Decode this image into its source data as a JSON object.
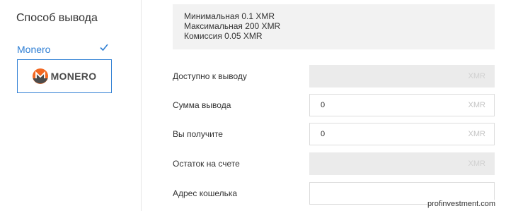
{
  "sidebar": {
    "title": "Способ вывода",
    "method_name": "Monero",
    "card_brand": "MONERO"
  },
  "info": {
    "lines": [
      "Минимальная 0.1 XMR",
      "Максимальная 200 XMR",
      "Комиссия 0.05 XMR"
    ]
  },
  "form": {
    "available": {
      "label": "Доступно к выводу",
      "value": "",
      "unit": "XMR"
    },
    "amount": {
      "label": "Сумма вывода",
      "value": "0",
      "unit": "XMR"
    },
    "receive": {
      "label": "Вы получите",
      "value": "0",
      "unit": "XMR"
    },
    "balance": {
      "label": "Остаток на счете",
      "value": "",
      "unit": "XMR"
    },
    "wallet": {
      "label": "Адрес кошелька",
      "value": ""
    }
  },
  "watermark": "profinvestment.com",
  "colors": {
    "accent": "#2f7fd4",
    "monero_orange": "#f26822",
    "monero_gray": "#4c4c4c"
  }
}
